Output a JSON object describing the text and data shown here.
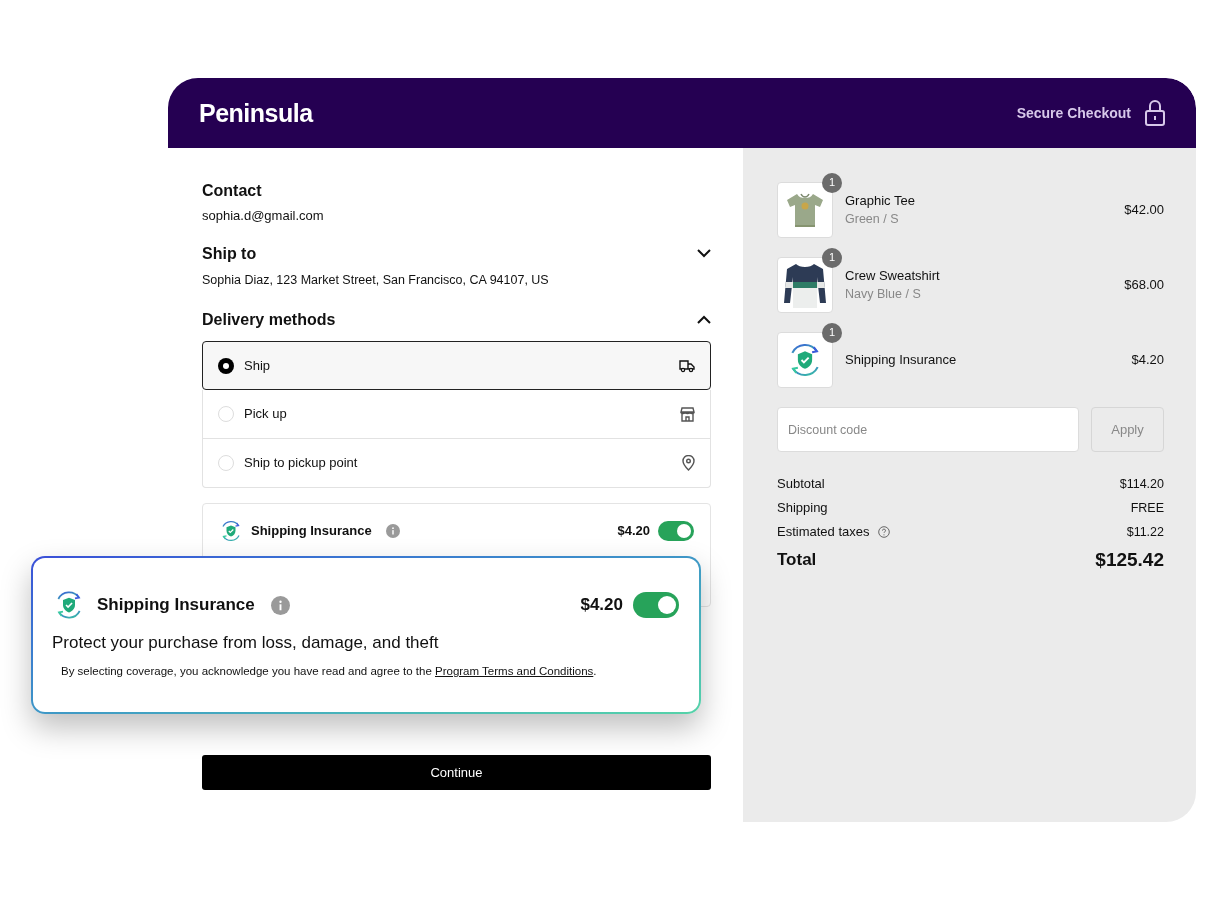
{
  "header": {
    "brand": "Peninsula",
    "secure_label": "Secure Checkout"
  },
  "contact": {
    "title": "Contact",
    "email": "sophia.d@gmail.com"
  },
  "ship_to": {
    "title": "Ship to",
    "address": "Sophia Diaz, 123 Market Street, San Francisco, CA 94107, US",
    "expanded": false
  },
  "delivery": {
    "title": "Delivery methods",
    "expanded": true,
    "options": [
      {
        "label": "Ship",
        "selected": true,
        "kind": "truck"
      },
      {
        "label": "Pick up",
        "selected": false,
        "kind": "store"
      },
      {
        "label": "Ship to pickup point",
        "selected": false,
        "kind": "pin"
      }
    ]
  },
  "insurance_card": {
    "title": "Shipping Insurance",
    "price": "$4.20",
    "on": true
  },
  "insurance_callout": {
    "title": "Shipping Insurance",
    "price": "$4.20",
    "on": true,
    "headline": "Protect your purchase from loss, damage, and theft",
    "disclaimer": "By selecting coverage, you acknowledge you have read and agree to the ",
    "link": "Program Terms and Conditions",
    "disclaimer_end": "."
  },
  "continue_label": "Continue",
  "order": {
    "items": [
      {
        "kind": "tee",
        "quantity": "1",
        "name": "Graphic Tee",
        "variant": "Green / S",
        "price": "$42.00"
      },
      {
        "kind": "sweatshirt",
        "quantity": "1",
        "name": "Crew Sweatshirt",
        "variant": "Navy Blue / S",
        "price": "$68.00"
      },
      {
        "kind": "insurance",
        "quantity": "1",
        "name": "Shipping Insurance",
        "price": "$4.20"
      }
    ],
    "discount_placeholder": "Discount code",
    "apply_label": "Apply",
    "summary": [
      {
        "label": "Subtotal",
        "value": "$114.20",
        "help": false
      },
      {
        "label": "Shipping",
        "value": "FREE",
        "help": false
      },
      {
        "label": "Estimated taxes",
        "value": "$11.22",
        "help": true
      }
    ],
    "total_label": "Total",
    "total_value": "$125.42"
  }
}
